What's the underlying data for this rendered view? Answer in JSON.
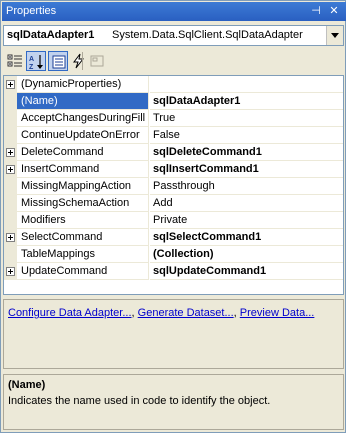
{
  "window": {
    "title": "Properties",
    "pin_glyph": "⊣",
    "close_glyph": "✕"
  },
  "object_selector": {
    "name": "sqlDataAdapter1",
    "type": "System.Data.SqlClient.SqlDataAdapter"
  },
  "toolbar": {
    "buttons": [
      {
        "icon": "categorized-icon",
        "active": false
      },
      {
        "icon": "alphabetical-icon",
        "active": true
      },
      {
        "icon": "properties-icon",
        "active": true
      },
      {
        "icon": "events-icon",
        "active": false
      },
      {
        "icon": "property-pages-icon",
        "active": false
      }
    ]
  },
  "grid": {
    "rows": [
      {
        "name": "(DynamicProperties)",
        "value": "",
        "expandable": true,
        "bold": false,
        "selected": false
      },
      {
        "name": "(Name)",
        "value": "sqlDataAdapter1",
        "expandable": false,
        "bold": true,
        "selected": true
      },
      {
        "name": "AcceptChangesDuringFill",
        "value": "True",
        "expandable": false,
        "bold": false,
        "selected": false
      },
      {
        "name": "ContinueUpdateOnError",
        "value": "False",
        "expandable": false,
        "bold": false,
        "selected": false
      },
      {
        "name": "DeleteCommand",
        "value": "sqlDeleteCommand1",
        "expandable": true,
        "bold": true,
        "selected": false
      },
      {
        "name": "InsertCommand",
        "value": "sqlInsertCommand1",
        "expandable": true,
        "bold": true,
        "selected": false
      },
      {
        "name": "MissingMappingAction",
        "value": "Passthrough",
        "expandable": false,
        "bold": false,
        "selected": false
      },
      {
        "name": "MissingSchemaAction",
        "value": "Add",
        "expandable": false,
        "bold": false,
        "selected": false
      },
      {
        "name": "Modifiers",
        "value": "Private",
        "expandable": false,
        "bold": false,
        "selected": false
      },
      {
        "name": "SelectCommand",
        "value": "sqlSelectCommand1",
        "expandable": true,
        "bold": true,
        "selected": false
      },
      {
        "name": "TableMappings",
        "value": "(Collection)",
        "expandable": false,
        "bold": true,
        "selected": false
      },
      {
        "name": "UpdateCommand",
        "value": "sqlUpdateCommand1",
        "expandable": true,
        "bold": true,
        "selected": false
      }
    ]
  },
  "verbs": {
    "configure": "Configure Data Adapter...",
    "generate": "Generate Dataset...",
    "preview": "Preview Data...",
    "separator": ","
  },
  "description": {
    "title": "(Name)",
    "text": "Indicates the name used in code to identify the object."
  },
  "colors": {
    "title_bar": "#2a5fc1",
    "selection": "#316ac5",
    "link": "#0000cc",
    "panel": "#ece9d8"
  }
}
